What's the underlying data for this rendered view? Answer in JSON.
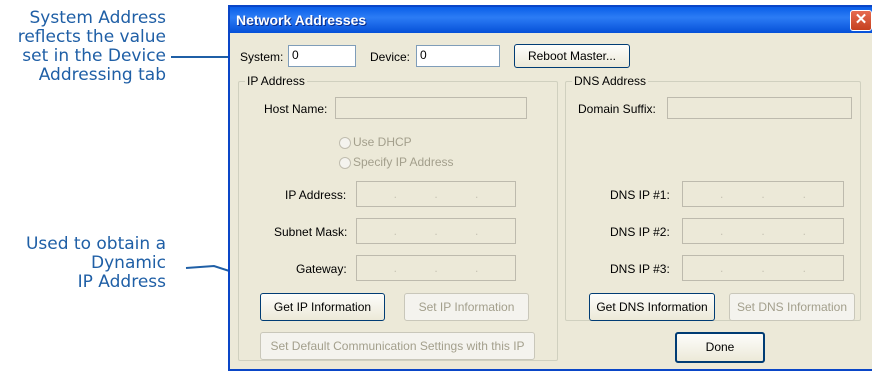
{
  "annotations": {
    "system_address": [
      "System Address",
      "reflects the value",
      "set in the Device",
      "Addressing tab"
    ],
    "dynamic_ip": [
      "Used to obtain a",
      "Dynamic",
      "IP Address"
    ]
  },
  "dialog": {
    "title": "Network Addresses",
    "close_glyph": "✕",
    "system_label": "System:",
    "system_value": "0",
    "device_label": "Device:",
    "device_value": "0",
    "reboot_label": "Reboot Master...",
    "ip_group": {
      "label": "IP Address",
      "host_name_label": "Host Name:",
      "use_dhcp_label": "Use DHCP",
      "specify_ip_label": "Specify IP Address",
      "ip_address_label": "IP Address:",
      "subnet_mask_label": "Subnet Mask:",
      "gateway_label": "Gateway:",
      "ip_sep": ".",
      "get_ip_label": "Get IP Information",
      "set_ip_label": "Set IP Information",
      "set_default_label": "Set Default Communication Settings with this IP"
    },
    "dns_group": {
      "label": "DNS Address",
      "domain_suffix_label": "Domain Suffix:",
      "dns1_label": "DNS IP #1:",
      "dns2_label": "DNS IP #2:",
      "dns3_label": "DNS IP #3:",
      "get_dns_label": "Get DNS Information",
      "set_dns_label": "Set DNS Information"
    },
    "done_label": "Done"
  }
}
